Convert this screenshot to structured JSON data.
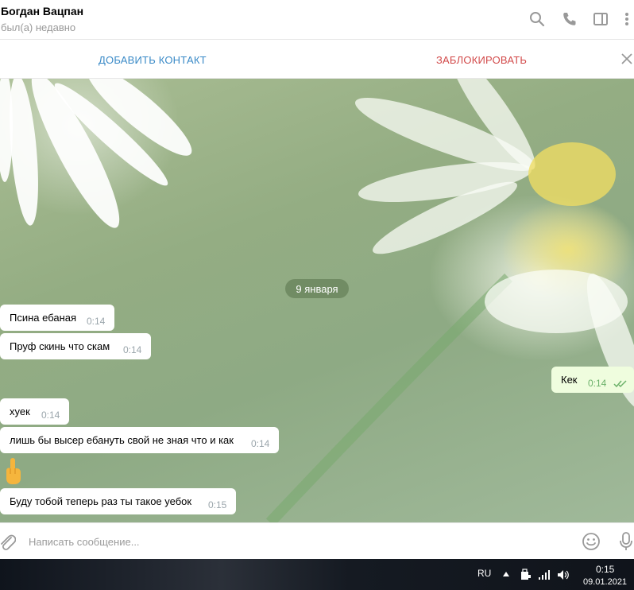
{
  "header": {
    "contact_name": "Богдан Вацпан",
    "status": "был(а) недавно",
    "icons": [
      "search-icon",
      "phone-icon",
      "sidebar-panel-icon",
      "more-vertical-icon"
    ]
  },
  "actionbar": {
    "add_contact": "ДОБАВИТЬ КОНТАКТ",
    "block": "ЗАБЛОКИРОВАТЬ",
    "add_color": "#3a8ac7",
    "block_color": "#d24a4a"
  },
  "chat": {
    "date": "9 января",
    "messages": [
      {
        "text": "Псина ебаная",
        "time": "0:14",
        "direction": "in"
      },
      {
        "text": "Пруф скинь что скам",
        "time": "0:14",
        "direction": "in"
      },
      {
        "text": "Кек",
        "time": "0:14",
        "direction": "out",
        "status": "read"
      },
      {
        "text": "хуек",
        "time": "0:14",
        "direction": "in"
      },
      {
        "text": "лишь бы высер ебануть свой не зная что и как",
        "time": "0:14",
        "direction": "in"
      },
      {
        "emoji": "middle-finger-emoji",
        "direction": "in"
      },
      {
        "text": "Буду тобой теперь раз ты такое уебок",
        "time": "0:15",
        "direction": "in"
      }
    ]
  },
  "composer": {
    "placeholder": "Написать сообщение..."
  },
  "taskbar": {
    "lang": "RU",
    "time": "0:15",
    "date": "09.01.2021"
  }
}
